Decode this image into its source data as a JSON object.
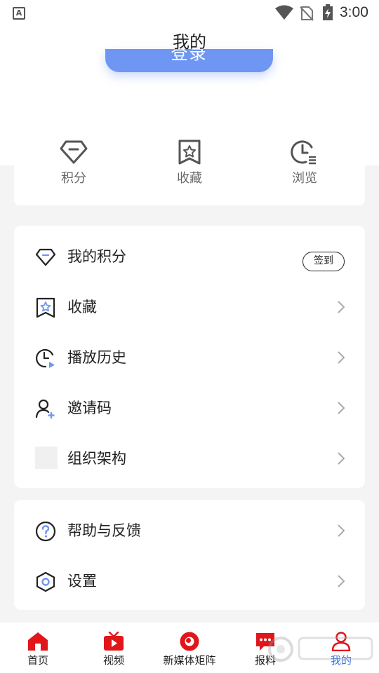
{
  "status_bar": {
    "time": "3:00"
  },
  "header": {
    "title": "我的",
    "login_label": "登录"
  },
  "quick_stats": [
    {
      "label": "积分",
      "icon": "diamond-icon"
    },
    {
      "label": "收藏",
      "icon": "bookmark-star-icon"
    },
    {
      "label": "浏览",
      "icon": "clock-list-icon"
    }
  ],
  "menu_main": [
    {
      "label": "我的积分",
      "icon": "diamond-icon",
      "action": "签到"
    },
    {
      "label": "收藏",
      "icon": "bookmark-star-icon"
    },
    {
      "label": "播放历史",
      "icon": "clock-play-icon"
    },
    {
      "label": "邀请码",
      "icon": "user-add-icon"
    },
    {
      "label": "组织架构",
      "icon": "placeholder-image"
    }
  ],
  "menu_secondary": [
    {
      "label": "帮助与反馈",
      "icon": "question-icon"
    },
    {
      "label": "设置",
      "icon": "hexagon-gear-icon"
    }
  ],
  "bottom_nav": [
    {
      "label": "首页",
      "icon": "home-icon"
    },
    {
      "label": "视频",
      "icon": "tv-icon"
    },
    {
      "label": "新媒体矩阵",
      "icon": "eye-circle-icon"
    },
    {
      "label": "报料",
      "icon": "chat-bubble-icon"
    },
    {
      "label": "我的",
      "icon": "user-icon",
      "active": true
    }
  ],
  "colors": {
    "accent": "#6e96f2",
    "brand_red": "#e0161b",
    "active_blue": "#3b73e0"
  }
}
